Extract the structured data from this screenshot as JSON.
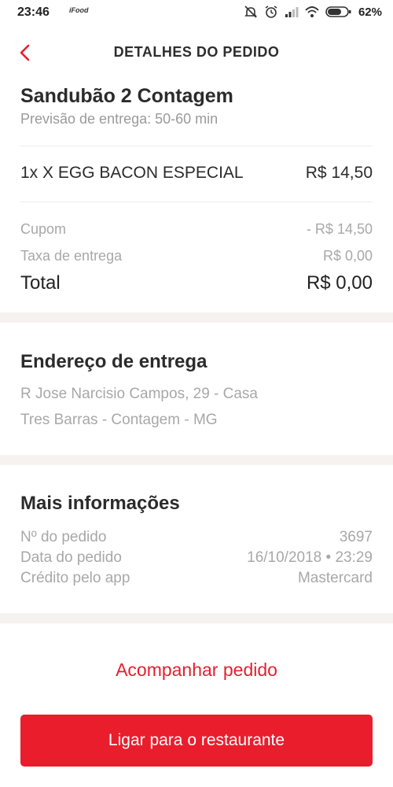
{
  "status_bar": {
    "time": "23:46",
    "app_label": "iFood",
    "battery": "62%",
    "icons": [
      "mute-icon",
      "alarm-icon",
      "signal-icon",
      "wifi-icon",
      "battery-icon"
    ]
  },
  "header": {
    "back_icon": "chevron-left-icon",
    "title": "DETALHES DO PEDIDO"
  },
  "order": {
    "restaurant": "Sandubão 2  Contagem",
    "delivery_estimate": "Previsão de entrega: 50-60 min",
    "items": [
      {
        "label": "1x X EGG BACON ESPECIAL",
        "price": "R$ 14,50"
      }
    ],
    "summary": [
      {
        "label": "Cupom",
        "value": "- R$ 14,50"
      },
      {
        "label": "Taxa de entrega",
        "value": "R$ 0,00"
      }
    ],
    "total_label": "Total",
    "total_value": "R$ 0,00"
  },
  "address": {
    "title": "Endereço de entrega",
    "line1": "R Jose Narcisio Campos, 29 - Casa",
    "line2": "Tres Barras - Contagem - MG"
  },
  "info": {
    "title": "Mais informações",
    "rows": [
      {
        "label": "Nº do pedido",
        "value": "3697"
      },
      {
        "label": "Data do pedido",
        "value": "16/10/2018 • 23:29"
      },
      {
        "label": "Crédito pelo app",
        "value": "Mastercard"
      }
    ]
  },
  "actions": {
    "track": "Acompanhar pedido",
    "call": "Ligar para o restaurante"
  },
  "colors": {
    "accent": "#ea1d2c",
    "muted": "#a8a8a8",
    "band": "#f6f2ef"
  }
}
